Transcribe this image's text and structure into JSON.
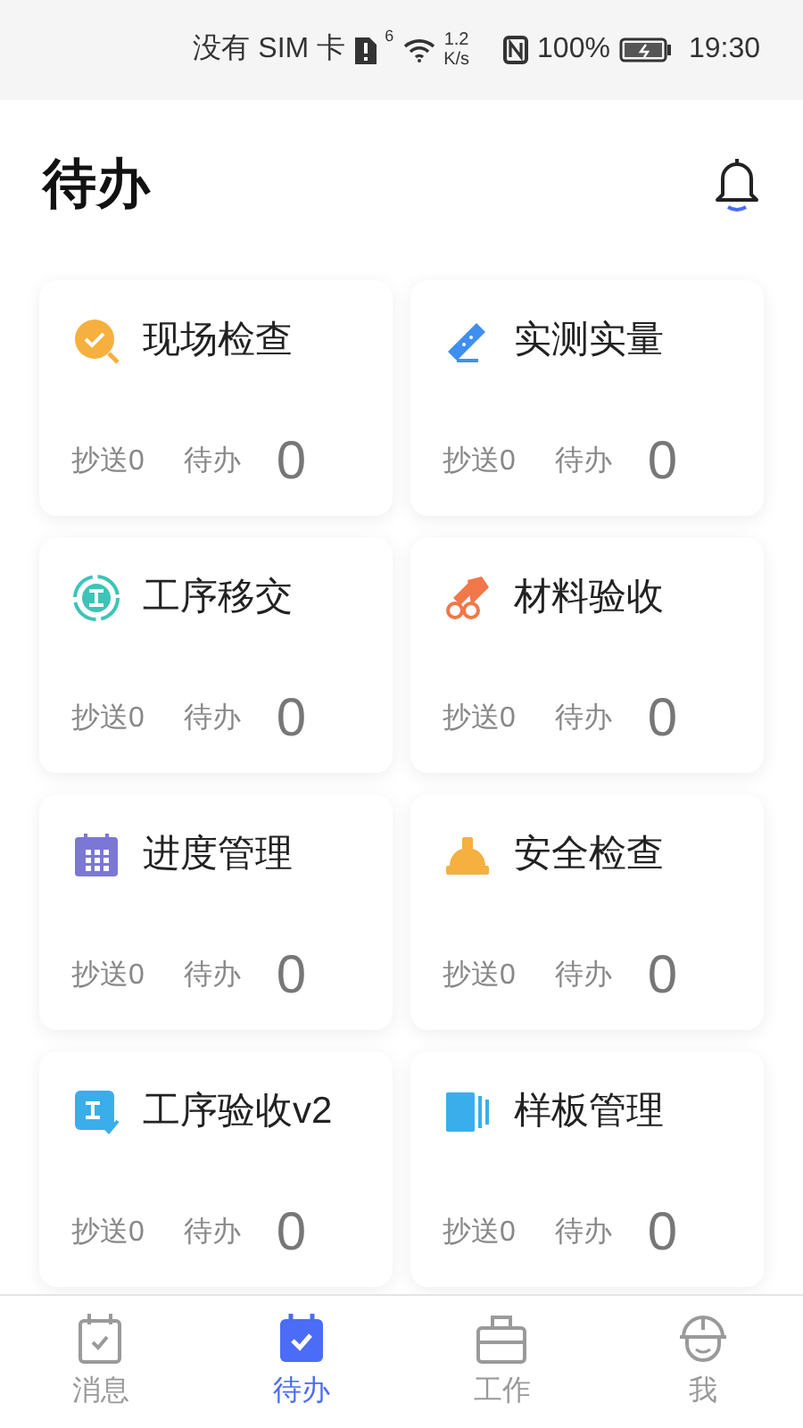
{
  "status_bar": {
    "carrier": "没有 SIM 卡",
    "network_superscript": "6",
    "speed_value": "1.2",
    "speed_unit": "K/s",
    "battery": "100%",
    "time": "19:30"
  },
  "header": {
    "title": "待办"
  },
  "cards": [
    {
      "kind": "inspection",
      "title": "现场检查",
      "cc_label": "抄送0",
      "todo_label": "待办",
      "count": "0"
    },
    {
      "kind": "ruler",
      "title": "实测实量",
      "cc_label": "抄送0",
      "todo_label": "待办",
      "count": "0"
    },
    {
      "kind": "handover",
      "title": "工序移交",
      "cc_label": "抄送0",
      "todo_label": "待办",
      "count": "0"
    },
    {
      "kind": "material",
      "title": "材料验收",
      "cc_label": "抄送0",
      "todo_label": "待办",
      "count": "0"
    },
    {
      "kind": "schedule",
      "title": "进度管理",
      "cc_label": "抄送0",
      "todo_label": "待办",
      "count": "0"
    },
    {
      "kind": "safety",
      "title": "安全检查",
      "cc_label": "抄送0",
      "todo_label": "待办",
      "count": "0"
    },
    {
      "kind": "acceptance",
      "title": "工序验收v2",
      "cc_label": "抄送0",
      "todo_label": "待办",
      "count": "0"
    },
    {
      "kind": "sample",
      "title": "样板管理",
      "cc_label": "抄送0",
      "todo_label": "待办",
      "count": "0"
    }
  ],
  "tab_bar": [
    {
      "kind": "calendar",
      "label": "消息",
      "selected": false
    },
    {
      "kind": "calendar",
      "label": "待办",
      "selected": true
    },
    {
      "kind": "briefcase",
      "label": "工作",
      "selected": false
    },
    {
      "kind": "helmet",
      "label": "我",
      "selected": false
    }
  ]
}
